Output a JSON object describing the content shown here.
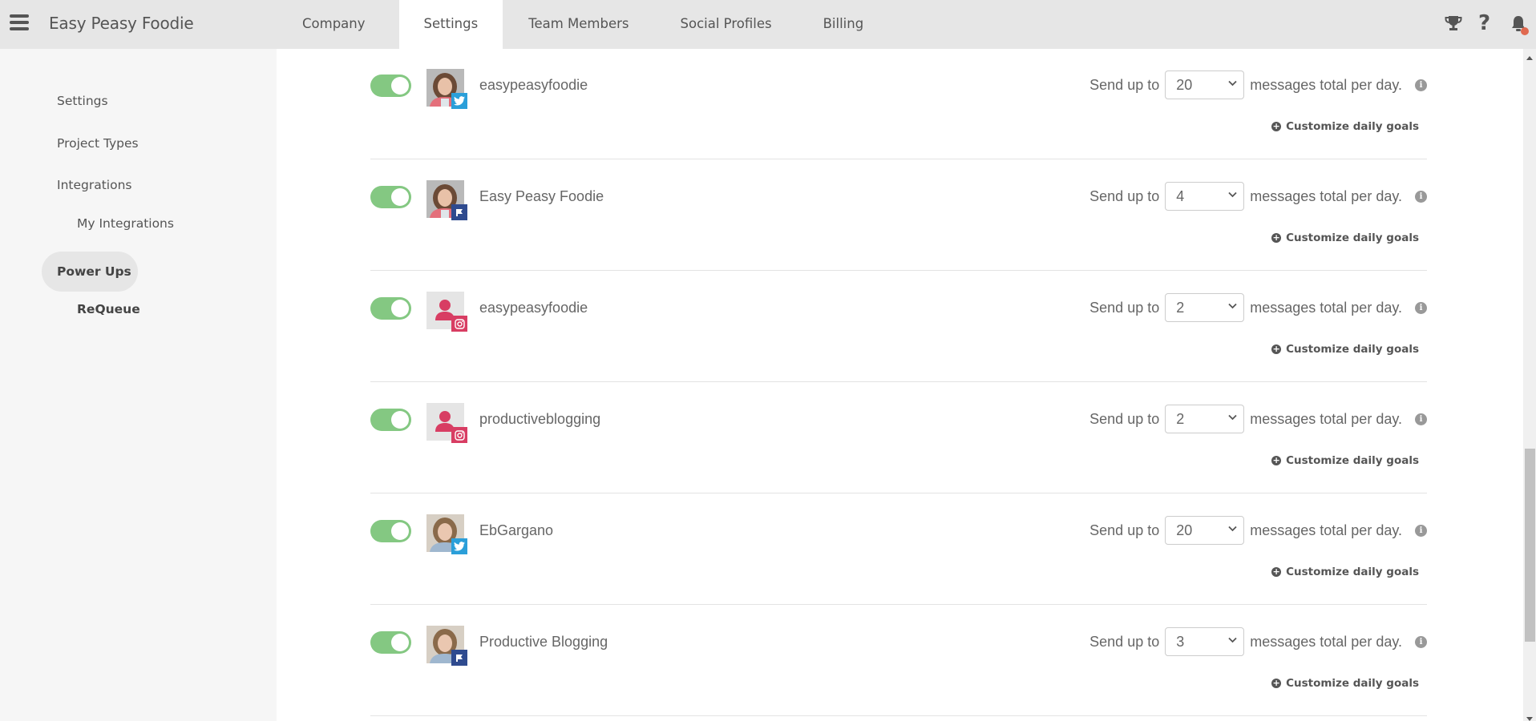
{
  "app": {
    "title": "Easy Peasy Foodie"
  },
  "nav": {
    "tabs": [
      {
        "label": "Company",
        "active": false
      },
      {
        "label": "Settings",
        "active": true
      },
      {
        "label": "Team Members",
        "active": false
      },
      {
        "label": "Social Profiles",
        "active": false
      },
      {
        "label": "Billing",
        "active": false
      }
    ],
    "icons": [
      "trophy-icon",
      "help-icon",
      "bell-icon"
    ],
    "help_glyph": "?",
    "notification_dot_color": "#e0694f"
  },
  "sidebar": {
    "items": [
      {
        "label": "Settings",
        "level": 0,
        "active": false
      },
      {
        "label": "Project Types",
        "level": 0,
        "active": false
      },
      {
        "label": "Integrations",
        "level": 0,
        "active": false
      },
      {
        "label": "My Integrations",
        "level": 1,
        "active": false
      },
      {
        "label": "Power Ups",
        "level": 0,
        "active": true
      },
      {
        "label": "ReQueue",
        "level": 1,
        "active": true
      }
    ]
  },
  "profiles": {
    "send_prefix": "Send up to",
    "send_suffix": "messages total per day.",
    "customize_label": "Customize daily goals",
    "info_glyph": "i",
    "plus_glyph": "+",
    "rows": [
      {
        "name": "easypeasyfoodie",
        "network": "twitter",
        "enabled": true,
        "limit": "20",
        "avatar": "photo-woman-1"
      },
      {
        "name": "Easy Peasy Foodie",
        "network": "facebook",
        "enabled": true,
        "limit": "4",
        "avatar": "photo-woman-1"
      },
      {
        "name": "easypeasyfoodie",
        "network": "instagram",
        "enabled": true,
        "limit": "2",
        "avatar": "placeholder-user"
      },
      {
        "name": "productiveblogging",
        "network": "instagram",
        "enabled": true,
        "limit": "2",
        "avatar": "placeholder-user"
      },
      {
        "name": "EbGargano",
        "network": "twitter",
        "enabled": true,
        "limit": "20",
        "avatar": "photo-woman-2"
      },
      {
        "name": "Productive Blogging",
        "network": "facebook",
        "enabled": true,
        "limit": "3",
        "avatar": "photo-woman-2"
      }
    ]
  },
  "colors": {
    "toggle_on": "#84c882",
    "twitter": "#2b9fd9",
    "facebook": "#2f4b8f",
    "instagram": "#d83d63"
  }
}
